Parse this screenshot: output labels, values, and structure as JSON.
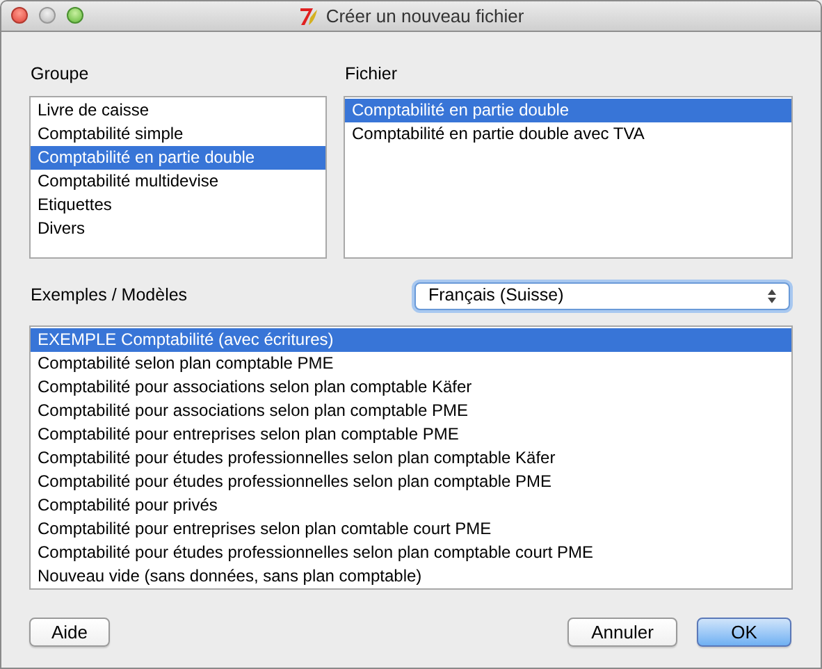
{
  "window": {
    "title": "Créer un nouveau fichier"
  },
  "group": {
    "label": "Groupe",
    "items": [
      {
        "label": "Livre de caisse",
        "selected": false
      },
      {
        "label": "Comptabilité simple",
        "selected": false
      },
      {
        "label": "Comptabilité en partie double",
        "selected": true
      },
      {
        "label": "Comptabilité multidevise",
        "selected": false
      },
      {
        "label": "Etiquettes",
        "selected": false
      },
      {
        "label": "Divers",
        "selected": false
      }
    ]
  },
  "file": {
    "label": "Fichier",
    "items": [
      {
        "label": "Comptabilité en partie double",
        "selected": true
      },
      {
        "label": "Comptabilité en partie double avec TVA",
        "selected": false
      }
    ]
  },
  "examples": {
    "label": "Exemples / Modèles",
    "language": "Français (Suisse)",
    "items": [
      {
        "label": "EXEMPLE Comptabilité (avec écritures)",
        "selected": true
      },
      {
        "label": "Comptabilité selon plan comptable PME",
        "selected": false
      },
      {
        "label": "Comptabilité pour associations selon plan comptable Käfer",
        "selected": false
      },
      {
        "label": "Comptabilité pour associations selon plan comptable PME",
        "selected": false
      },
      {
        "label": "Comptabilité pour entreprises selon plan comptable PME",
        "selected": false
      },
      {
        "label": "Comptabilité pour études professionnelles selon plan comptable Käfer",
        "selected": false
      },
      {
        "label": "Comptabilité pour études professionnelles selon plan comptable PME",
        "selected": false
      },
      {
        "label": "Comptabilité pour privés",
        "selected": false
      },
      {
        "label": "Comptabilité pour entreprises selon plan comtable court PME",
        "selected": false
      },
      {
        "label": "Comptabilité pour études professionnelles selon plan comptable court PME",
        "selected": false
      },
      {
        "label": "Nouveau vide (sans données, sans plan comptable)",
        "selected": false
      }
    ]
  },
  "buttons": [
    {
      "label": "Aide",
      "kind": "help"
    },
    {
      "label": "Annuler",
      "kind": "cancel"
    },
    {
      "label": "OK",
      "kind": "default"
    }
  ]
}
